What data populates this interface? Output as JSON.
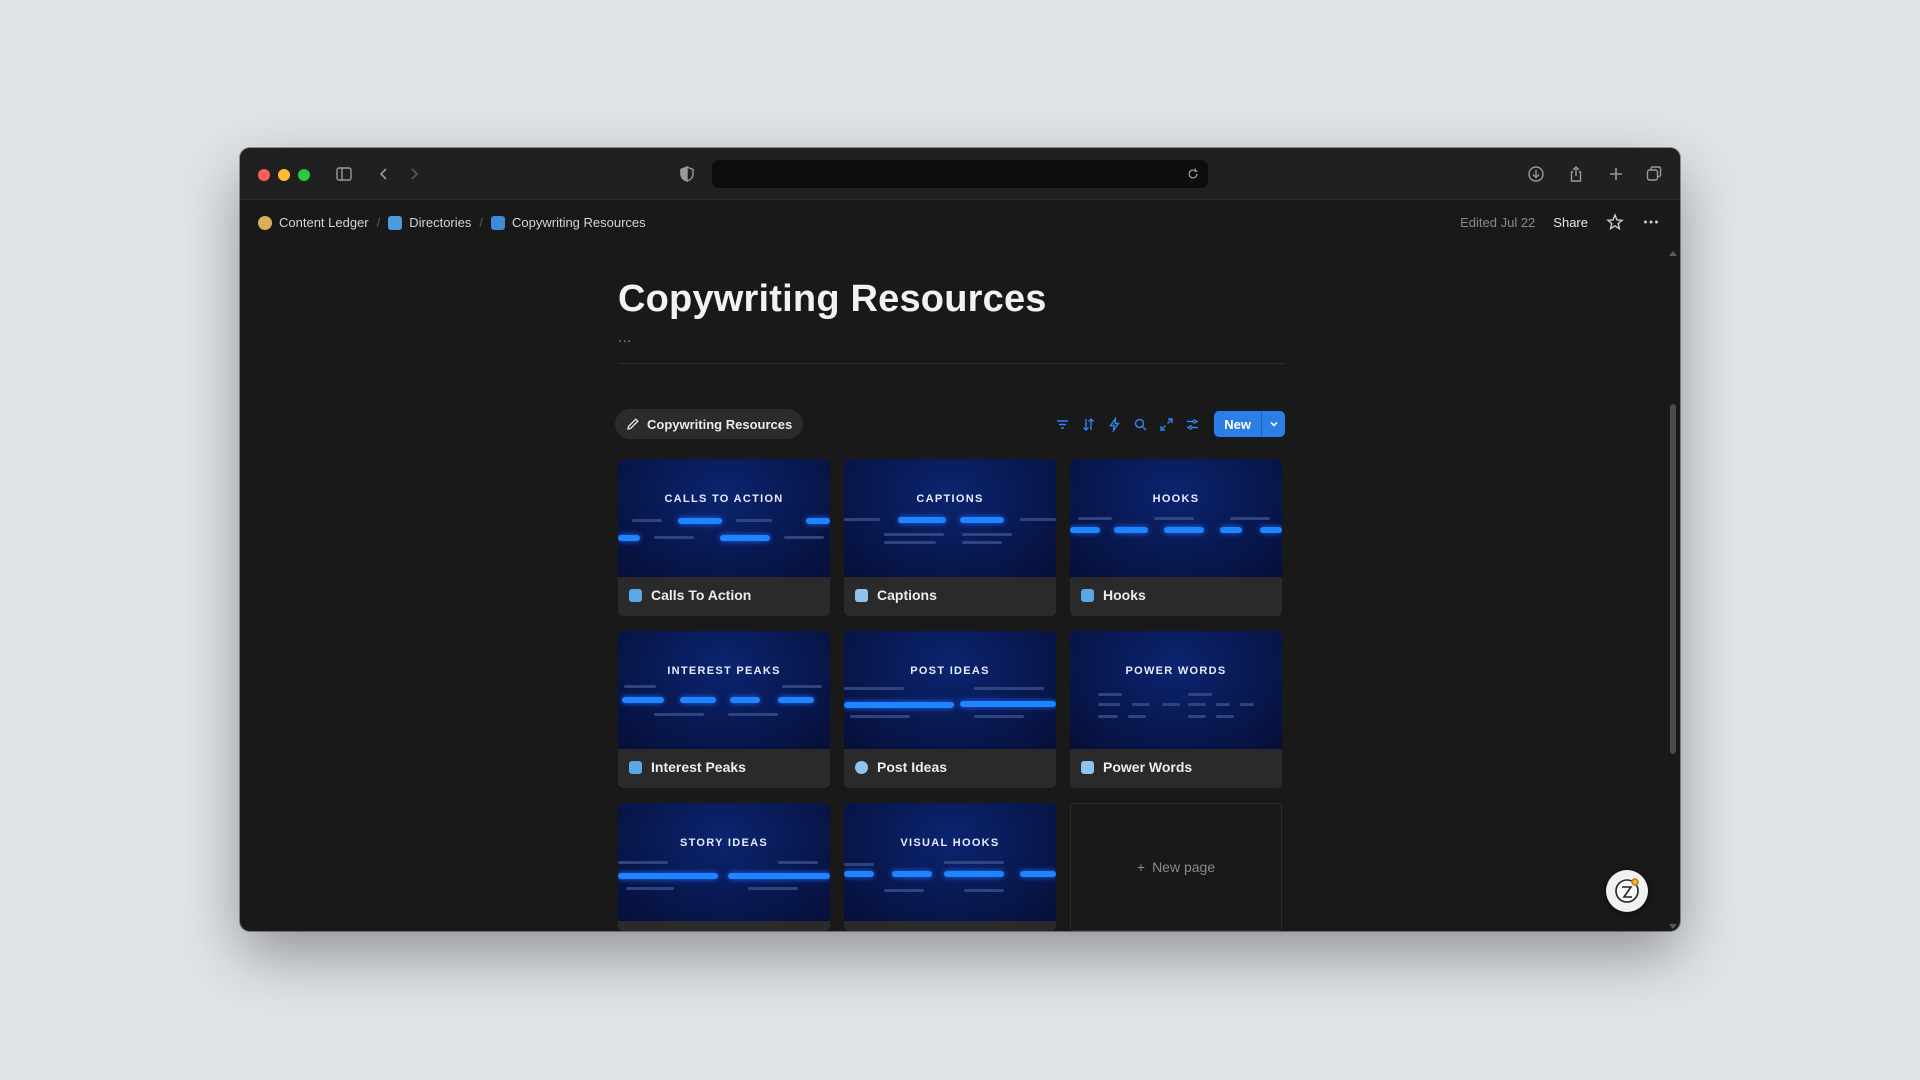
{
  "browser": {
    "address_value": "",
    "traffic_lights": [
      "#ff5f57",
      "#febc2e",
      "#28c840"
    ]
  },
  "breadcrumb": [
    {
      "label": "Content Ledger",
      "icon": "person-icon"
    },
    {
      "label": "Directories",
      "icon": "directory-icon"
    },
    {
      "label": "Copywriting Resources",
      "icon": "book-icon"
    }
  ],
  "header": {
    "edited": "Edited Jul 22",
    "share": "Share"
  },
  "page": {
    "title": "Copywriting Resources",
    "dots": "..."
  },
  "database": {
    "view_tab": "Copywriting Resources",
    "new_label": "New",
    "accent": "#2b7ee5",
    "tools": [
      "filter-icon",
      "sort-icon",
      "lightning-icon",
      "search-icon",
      "expand-icon",
      "settings-icon"
    ]
  },
  "cards": [
    {
      "thumb_title": "CALLS TO ACTION",
      "label": "Calls To Action"
    },
    {
      "thumb_title": "CAPTIONS",
      "label": "Captions"
    },
    {
      "thumb_title": "HOOKS",
      "label": "Hooks"
    },
    {
      "thumb_title": "INTEREST PEAKS",
      "label": "Interest Peaks"
    },
    {
      "thumb_title": "POST IDEAS",
      "label": "Post Ideas"
    },
    {
      "thumb_title": "POWER WORDS",
      "label": "Power Words"
    },
    {
      "thumb_title": "STORY IDEAS",
      "label": ""
    },
    {
      "thumb_title": "VISUAL HOOKS",
      "label": ""
    }
  ],
  "new_page": "New page"
}
